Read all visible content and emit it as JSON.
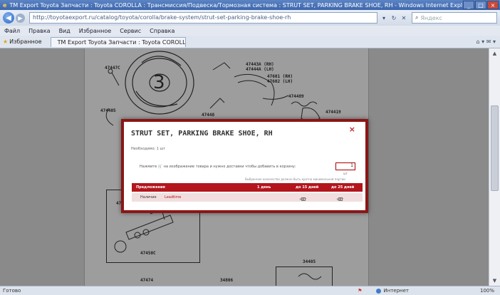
{
  "window": {
    "title": "TM Export Toyota Запчасти : Toyota COROLLA : Трансмиссия/Подвеска/Тормозная система : STRUT SET, PARKING BRAKE SHOE, RH - Windows Internet Explorer",
    "btn_min": "_",
    "btn_max": "□",
    "btn_close": "×"
  },
  "address": {
    "back": "◀",
    "forward": "▶",
    "url": "http://toyotaexport.ru/catalog/toyota/corolla/brake-system/strut-set-parking-brake-shoe-rh",
    "search_placeholder": "Яндекс",
    "tool_refresh": "↻",
    "tool_stop": "✕",
    "tool_dropdown": "▾"
  },
  "menu": {
    "items": [
      "Файл",
      "Правка",
      "Вид",
      "Избранное",
      "Сервис",
      "Справка"
    ]
  },
  "favorites": {
    "label": "Избранное",
    "tab": "TM Export Toyota Запчасти : Toyota COROLLA : Трансмиссия/Т...",
    "tools": "⌂ ▾  ✉ ▾"
  },
  "diagram": {
    "labels": [
      "47447C",
      "47443A (RH)",
      "47444A (LH)",
      "47601 (RH)",
      "47602 (LH)",
      "474405",
      "47448",
      "474489",
      "474419",
      "47420",
      "47450C",
      "47474",
      "34806",
      "34405"
    ]
  },
  "modal": {
    "title": "STRUT SET, PARKING BRAKE SHOE, RH",
    "close": "×",
    "required": "Необходимо: 1 шт",
    "prompt": "Нажмите 🛒 на изображение товара и нужно доставки чтобы добавить в корзину:",
    "qty": "1",
    "qty_unit": "шт",
    "note": "Выбранное количество должно быть кратно минимальной партии",
    "table": {
      "headers": [
        "Предложения",
        "1 день",
        "до 15 дней",
        "до 25 дней"
      ],
      "row": {
        "name": "Наличие",
        "supplier": "Leadtime",
        "price1": "",
        "price2": "нет",
        "price3": "нет"
      }
    }
  },
  "scrollbar": {
    "up": "▲",
    "down": "▼"
  },
  "status": {
    "left": "Готово",
    "zone": "Интернет",
    "zoom": "100%"
  }
}
